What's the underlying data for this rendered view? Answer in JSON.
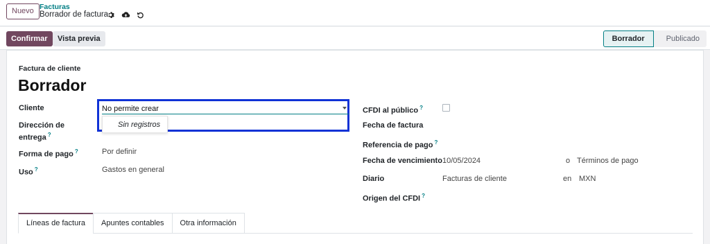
{
  "topbar": {
    "new_label": "Nuevo",
    "breadcrumb": "Facturas",
    "record_name": "Borrador de factura"
  },
  "control": {
    "confirm_label": "Confirmar",
    "preview_label": "Vista previa",
    "status_stages": [
      "Borrador",
      "Publicado"
    ],
    "active_stage": "Borrador"
  },
  "sheet": {
    "move_type": "Factura de cliente",
    "state_title": "Borrador"
  },
  "left_fields": {
    "cliente": {
      "label": "Cliente",
      "value": "No permite crear",
      "dropdown_item": "Sin registros"
    },
    "direccion": {
      "label": "Dirección de entrega",
      "help": "?"
    },
    "forma_pago": {
      "label": "Forma de pago",
      "help": "?",
      "value": "Por definir"
    },
    "uso": {
      "label": "Uso",
      "help": "?",
      "value": "Gastos en general"
    }
  },
  "right_fields": {
    "cfdi_publico": {
      "label": "CFDI al público",
      "help": "?",
      "checked": false
    },
    "fecha_factura": {
      "label": "Fecha de factura"
    },
    "referencia_pago": {
      "label": "Referencia de pago",
      "help": "?"
    },
    "fecha_vencimiento": {
      "label": "Fecha de vencimiento",
      "value": "10/05/2024",
      "connector": "o",
      "alt_value": "Términos de pago"
    },
    "diario": {
      "label": "Diario",
      "value": "Facturas de cliente",
      "connector": "en",
      "currency": "MXN"
    },
    "origen_cfdi": {
      "label": "Origen del CFDI",
      "help": "?"
    }
  },
  "tabs": [
    {
      "label": "Líneas de factura",
      "active": true
    },
    {
      "label": "Apuntes contables",
      "active": false
    },
    {
      "label": "Otra información",
      "active": false
    }
  ],
  "colors": {
    "brand": "#71475f",
    "teal": "#017e84",
    "highlight_box": "#1032d6"
  },
  "icons": [
    "gear-icon",
    "cloud-upload-icon",
    "undo-icon",
    "caret-down-icon",
    "help-icon"
  ]
}
